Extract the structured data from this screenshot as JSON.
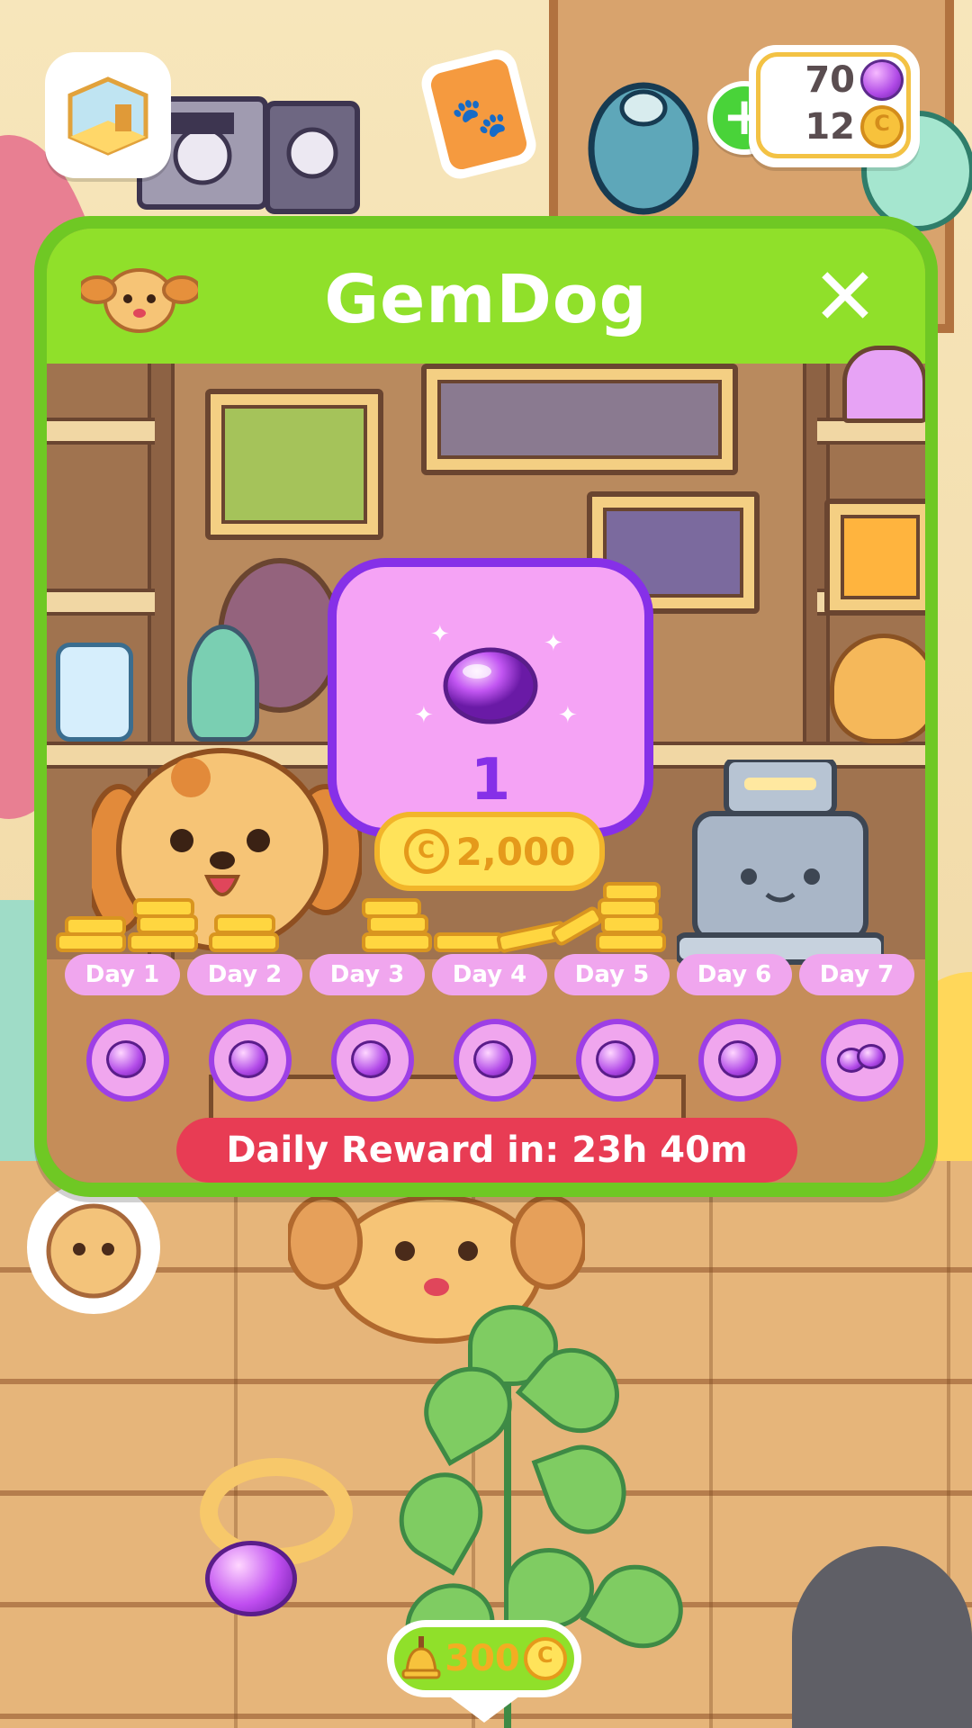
{
  "hud": {
    "gems": "70",
    "coins": "12",
    "add_currency_symbol": "+",
    "coin_symbol": "C"
  },
  "modal": {
    "title": "GemDog",
    "close_symbol": "✕",
    "reward": {
      "quantity": "1",
      "price": "2,000",
      "price_symbol": "C"
    },
    "days": [
      {
        "label": "Day 1",
        "reward": "gem"
      },
      {
        "label": "Day 2",
        "reward": "gem"
      },
      {
        "label": "Day 3",
        "reward": "gem"
      },
      {
        "label": "Day 4",
        "reward": "gem"
      },
      {
        "label": "Day 5",
        "reward": "gem"
      },
      {
        "label": "Day 6",
        "reward": "gem"
      },
      {
        "label": "Day 7",
        "reward": "gem-pile"
      }
    ],
    "timer": "Daily Reward in: 23h 40m"
  },
  "bottom": {
    "bell_cost": "300",
    "coin_symbol": "C"
  },
  "colors": {
    "header_green": "#90e02a",
    "frame_green": "#6fc824",
    "gem_purple": "#8630e8",
    "reward_pink": "#f5a3f5",
    "timer_red": "#e83c54",
    "coin_gold": "#f7c23c"
  }
}
